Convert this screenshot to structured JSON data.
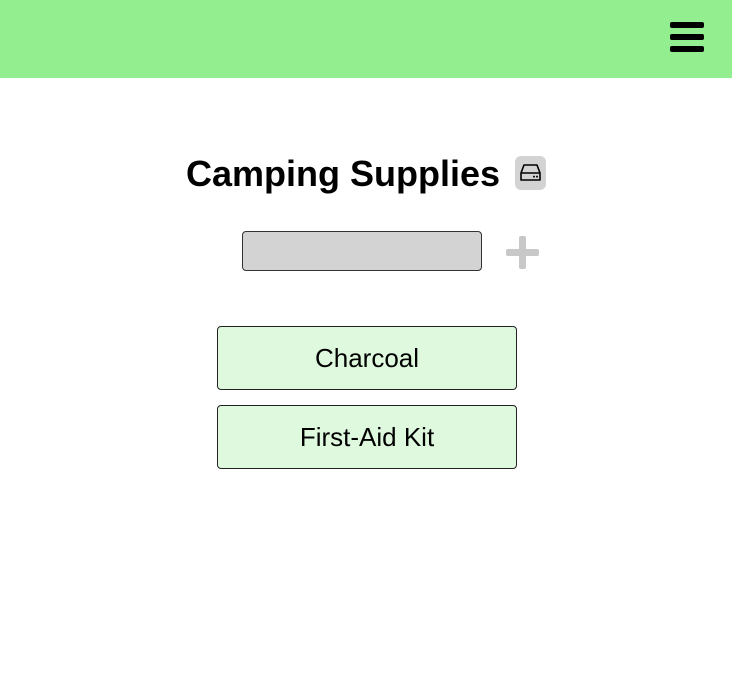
{
  "header": {
    "menu_icon": "hamburger-menu-icon",
    "background_color": "#93ee90"
  },
  "list": {
    "title": "Camping Supplies",
    "storage_icon": "hard-drive-icon",
    "new_item_input": {
      "value": "",
      "placeholder": ""
    },
    "add_icon": "plus-icon",
    "items": [
      {
        "label": "Charcoal"
      },
      {
        "label": "First-Aid Kit"
      }
    ],
    "item_background_color": "#dff9de"
  }
}
